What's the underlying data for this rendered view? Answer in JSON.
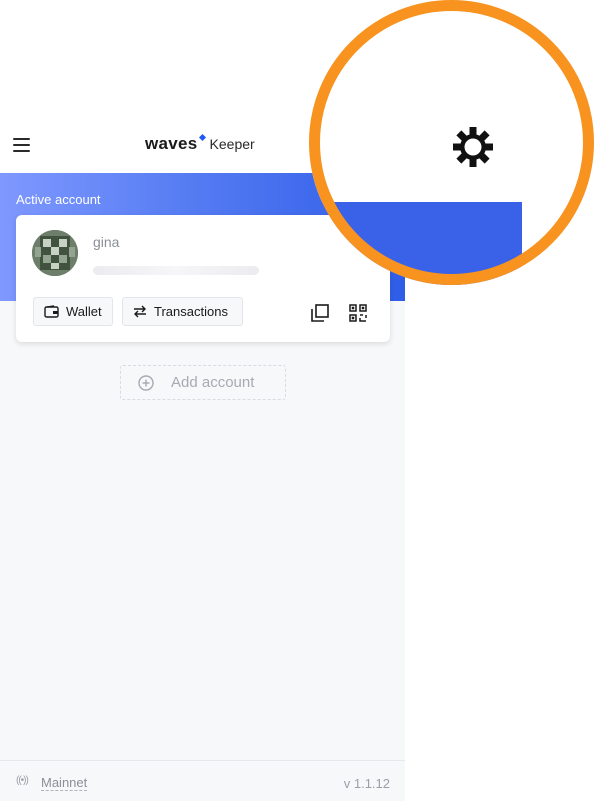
{
  "header": {
    "brand_primary": "waves",
    "brand_secondary": "Keeper"
  },
  "account": {
    "section_label": "Active account",
    "name": "gina",
    "wallet_label": "Wallet",
    "transactions_label": "Transactions"
  },
  "actions": {
    "add_account_label": "Add account"
  },
  "footer": {
    "network": "Mainnet",
    "version": "v 1.1.12"
  },
  "icons": {
    "menu": "menu-icon",
    "settings": "gear-icon",
    "wallet": "wallet-icon",
    "transactions": "transfer-arrows-icon",
    "copy": "copy-icon",
    "qr": "qr-code-icon",
    "add": "plus-circle-icon",
    "network": "signal-icon"
  },
  "colors": {
    "accent_blue": "#1f5af6",
    "callout_ring": "#f7931e"
  }
}
